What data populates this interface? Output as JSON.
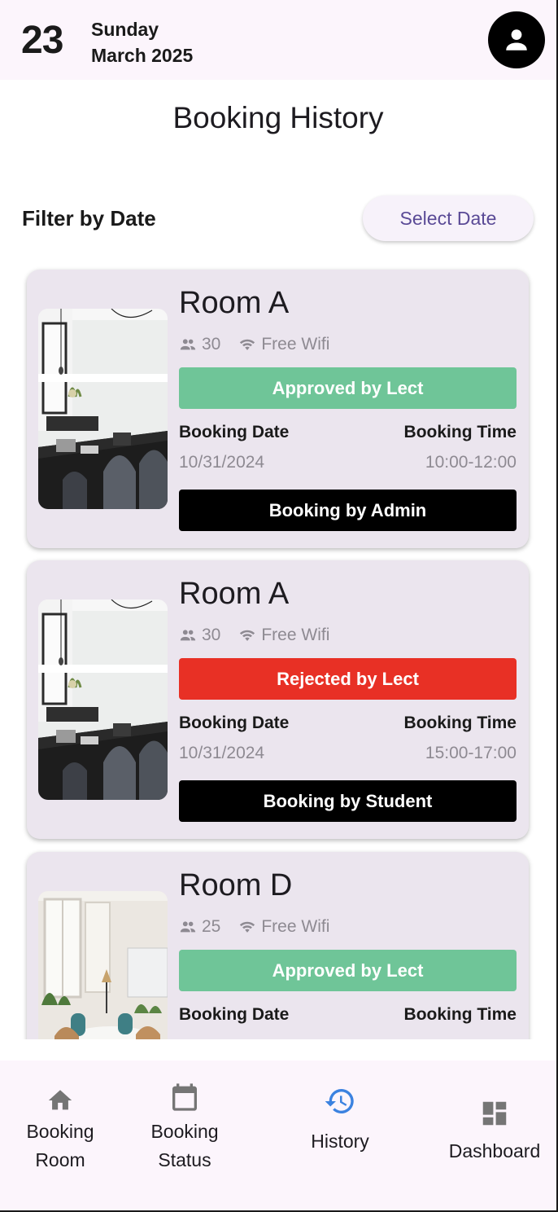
{
  "header": {
    "day_number": "23",
    "weekday": "Sunday",
    "month_year": "March 2025"
  },
  "page": {
    "title": "Booking History"
  },
  "filter": {
    "label": "Filter by Date",
    "button_label": "Select Date"
  },
  "bookings": [
    {
      "room": "Room A",
      "capacity": "30",
      "amenity": "Free Wifi",
      "status": "Approved by Lect",
      "status_color": "#6fc598",
      "date_label": "Booking Date",
      "time_label": "Booking Time",
      "date": "10/31/2024",
      "time": "10:00-12:00",
      "booked_by": "Booking by Admin"
    },
    {
      "room": "Room A",
      "capacity": "30",
      "amenity": "Free Wifi",
      "status": "Rejected by Lect",
      "status_color": "#e83025",
      "date_label": "Booking Date",
      "time_label": "Booking Time",
      "date": "10/31/2024",
      "time": "15:00-17:00",
      "booked_by": "Booking by Student"
    },
    {
      "room": "Room D",
      "capacity": "25",
      "amenity": "Free Wifi",
      "status": "Approved by Lect",
      "status_color": "#6fc598",
      "date_label": "Booking Date",
      "time_label": "Booking Time"
    }
  ],
  "nav": {
    "items": [
      {
        "line1": "Booking",
        "line2": "Room",
        "icon": "home-icon"
      },
      {
        "line1": "Booking",
        "line2": "Status",
        "icon": "calendar-icon"
      },
      {
        "line1": "History",
        "line2": "",
        "icon": "history-icon",
        "active": true
      },
      {
        "line1": "Dashboard",
        "line2": "",
        "icon": "dashboard-icon"
      }
    ],
    "active_color": "#3b82e0",
    "inactive_icon_color": "#757575"
  }
}
